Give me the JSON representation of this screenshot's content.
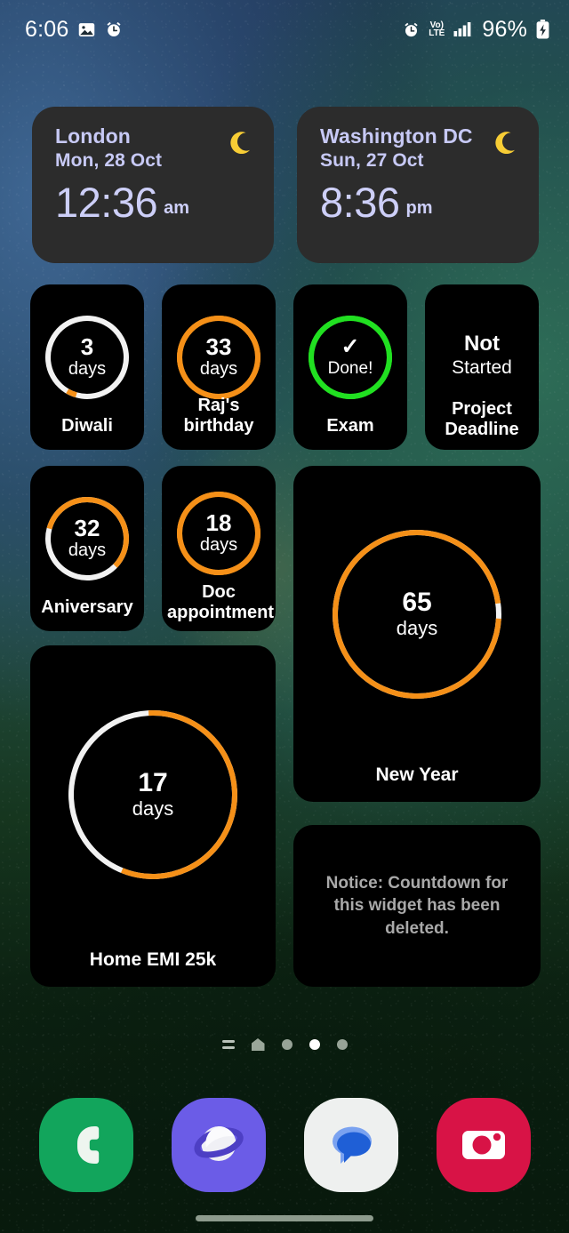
{
  "status_bar": {
    "clock": "6:06",
    "left_icons": [
      "image-icon",
      "alarm-icon"
    ],
    "volte_top": "Vo)",
    "volte_bottom": "LTE",
    "battery_percent": "96%",
    "right_icons": [
      "alarm-icon",
      "volte-icon",
      "signal-icon",
      "battery-charging-icon"
    ]
  },
  "clock_widgets": [
    {
      "city": "London",
      "date": "Mon, 28 Oct",
      "time": "12:36",
      "ampm": "am",
      "icon": "crescent-moon-icon"
    },
    {
      "city": "Washington DC",
      "date": "Sun, 27 Oct",
      "time": "8:36",
      "ampm": "pm",
      "icon": "crescent-moon-icon"
    }
  ],
  "countdown_widgets": [
    {
      "title": "Diwali",
      "number": "3",
      "unit": "days",
      "ring": {
        "progress_pct": 4,
        "start_deg": 196,
        "progress_color": "#f59018",
        "track_color": "#f2f2f2"
      }
    },
    {
      "title": "Raj's birthday",
      "number": "33",
      "unit": "days",
      "ring": {
        "progress_pct": 100,
        "start_deg": 0,
        "progress_color": "#f59018",
        "track_color": "#f59018"
      }
    },
    {
      "title": "Exam",
      "status": "Done!",
      "check": "✓",
      "ring": {
        "progress_pct": 100,
        "start_deg": 0,
        "progress_color": "#21e021",
        "track_color": "#21e021"
      }
    },
    {
      "title_line1": "Project",
      "title_line2": "Deadline",
      "state_bold": "Not",
      "state_regular": "Started"
    },
    {
      "title": "Aniversary",
      "number": "32",
      "unit": "days",
      "ring": {
        "progress_pct": 58,
        "start_deg": 285,
        "progress_color": "#f59018",
        "track_color": "#f2f2f2"
      }
    },
    {
      "title_line1": "Doc",
      "title_line2": "appointment",
      "number": "18",
      "unit": "days",
      "ring": {
        "progress_pct": 100,
        "start_deg": 0,
        "progress_color": "#f59018",
        "track_color": "#f59018"
      }
    },
    {
      "title": "New Year",
      "number": "65",
      "unit": "days",
      "ring": {
        "progress_pct": 97,
        "start_deg": 93,
        "progress_color": "#f59018",
        "track_color": "#f2f2f2"
      }
    },
    {
      "title": "Home EMI 25k",
      "number": "17",
      "unit": "days",
      "ring": {
        "progress_pct": 57,
        "start_deg": 357,
        "progress_color": "#f59018",
        "track_color": "#f2f2f2"
      }
    },
    {
      "notice": "Notice: Countdown for this widget has been deleted."
    }
  ],
  "page_indicator": {
    "icons": [
      "lines-icon",
      "home-icon"
    ],
    "dots": 3,
    "active_dot": 1
  },
  "dock": {
    "apps": [
      {
        "name": "Phone",
        "icon": "phone-icon",
        "bg": "#12a55c"
      },
      {
        "name": "Internet",
        "icon": "globe-icon",
        "bg": "#6b5ce7"
      },
      {
        "name": "Messages",
        "icon": "chat-bubble-icon",
        "bg": "#eef0ef"
      },
      {
        "name": "Camera",
        "icon": "camera-icon",
        "bg": "#d81346"
      }
    ]
  },
  "colors": {
    "accent_orange": "#f59018",
    "done_green": "#21e021",
    "clock_text": "#c7c9f5",
    "card_bg": "#000000",
    "clock_card_bg": "#2c2c2c"
  }
}
